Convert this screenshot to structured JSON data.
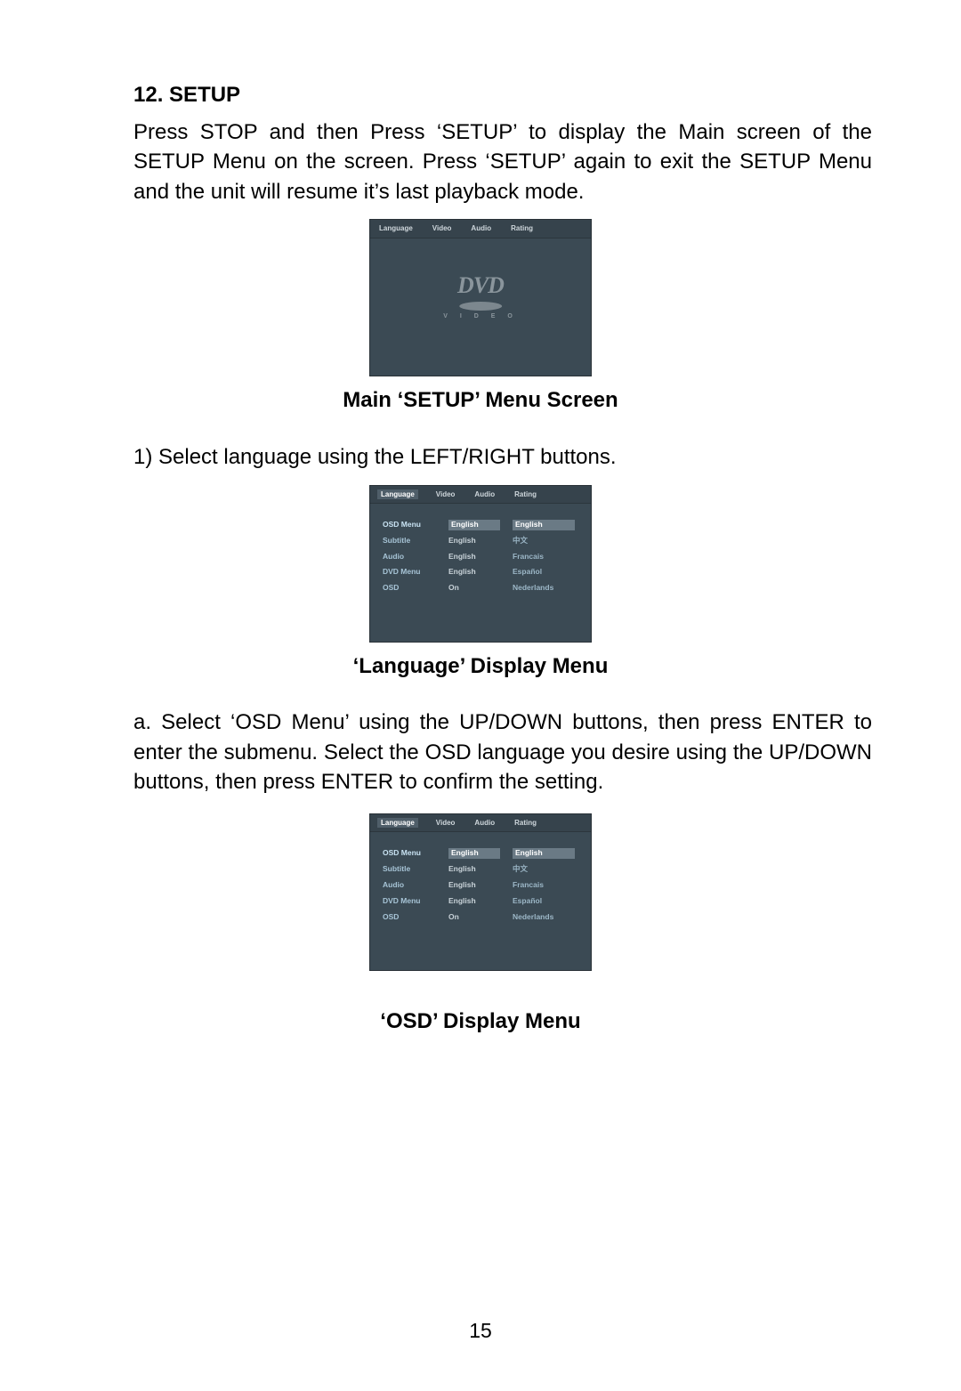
{
  "section": {
    "number": "12.",
    "title": "SETUP"
  },
  "intro": "Press STOP and then Press ‘SETUP’ to display the Main screen of the SETUP Menu on the screen. Press ‘SETUP’ again to exit  the SETUP Menu and the unit  will resume it’s last playback mode.",
  "shot1": {
    "tabs": [
      "Language",
      "Video",
      "Audio",
      "Rating"
    ],
    "logo": {
      "text": "DVD",
      "sub": "V I D E O"
    }
  },
  "caption1": "Main ‘SETUP’ Menu Screen",
  "step1": "1) Select language using the LEFT/RIGHT buttons.",
  "shot2": {
    "tabs": [
      "Language",
      "Video",
      "Audio",
      "Rating"
    ],
    "col_left": [
      "OSD Menu",
      "Subtitle",
      "Audio",
      "DVD Menu",
      "OSD"
    ],
    "col_mid": [
      "English",
      "English",
      "English",
      "English",
      "On"
    ],
    "col_right": [
      "English",
      "中文",
      "Francais",
      "Español",
      "Nederlands"
    ]
  },
  "caption2": "‘Language’ Display Menu",
  "osd_para": "a.  Select  ‘OSD  Menu’  using  the  UP/DOWN  buttons,  then  press ENTER to enter  the submenu. Select  the OSD  language you desire using  the UP/DOWN buttons,  then press ENTER to confirm the setting.",
  "shot3": {
    "tabs": [
      "Language",
      "Video",
      "Audio",
      "Rating"
    ],
    "col_left": [
      "OSD Menu",
      "Subtitle",
      "Audio",
      "DVD Menu",
      "OSD"
    ],
    "col_mid": [
      "English",
      "English",
      "English",
      "English",
      "On"
    ],
    "col_right": [
      "English",
      "中文",
      "Francais",
      "Español",
      "Nederlands"
    ]
  },
  "caption3": "‘OSD’ Display Menu",
  "page_number": "15"
}
